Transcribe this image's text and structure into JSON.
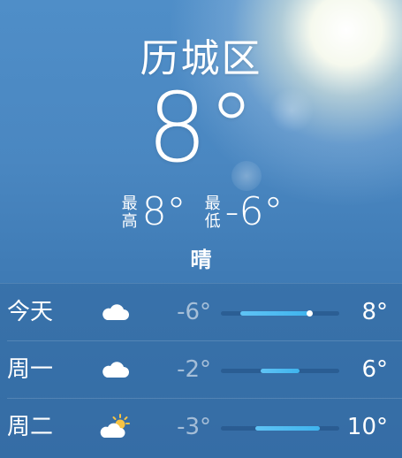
{
  "location": {
    "city": "历城区",
    "current_temp": "8°",
    "high_label": "最高",
    "high": "8°",
    "low_label": "最低",
    "low": "-6°",
    "condition": "晴"
  },
  "forecast": [
    {
      "day": "今天",
      "icon": "cloud-icon",
      "low": "-6°",
      "high": "8°",
      "low_value": -6,
      "high_value": 8,
      "current_value": 8
    },
    {
      "day": "周一",
      "icon": "cloud-icon",
      "low": "-2°",
      "high": "6°",
      "low_value": -2,
      "high_value": 6
    },
    {
      "day": "周二",
      "icon": "partly-sunny-icon",
      "low": "-3°",
      "high": "10°",
      "low_value": -3,
      "high_value": 10
    }
  ],
  "forecast_range": [
    -10,
    14
  ],
  "colors": {
    "bar_fill": "#5fc3f5",
    "bar_track": "#2c5f96",
    "sun": "#f6c344"
  }
}
